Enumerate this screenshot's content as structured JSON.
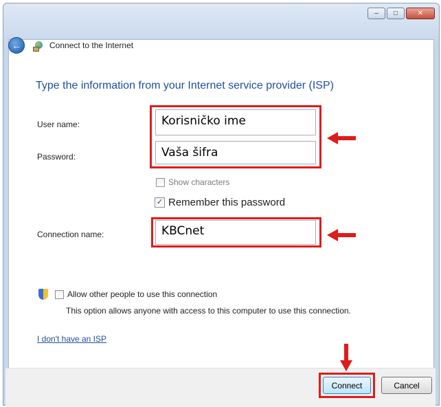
{
  "window": {
    "title": "Connect to the Internet",
    "controls": {
      "minimize": "–",
      "maximize": "□",
      "close": "✕"
    },
    "icons": {
      "back": "back-arrow-icon",
      "network": "network-icon"
    }
  },
  "form": {
    "heading": "Type the information from your Internet service provider (ISP)",
    "user_name_label": "User name:",
    "user_name_value": "Korisničko ime",
    "password_label": "Password:",
    "password_value": "Vaša šifra",
    "show_characters_label": "Show characters",
    "show_characters_checked": false,
    "remember_password_label": "Remember this password",
    "remember_password_checked": true,
    "connection_name_label": "Connection name:",
    "connection_name_value": "KBCnet",
    "allow_others_label": "Allow other people to use this connection",
    "allow_others_checked": false,
    "allow_others_description": "This option allows anyone with access to this computer to use this connection.",
    "no_isp_link": "I don't have an ISP"
  },
  "buttons": {
    "connect": "Connect",
    "cancel": "Cancel"
  },
  "annotations": {
    "highlight_color": "#e01b1b"
  },
  "colors": {
    "heading": "#1f4e9e",
    "link": "#1f4e9e"
  }
}
